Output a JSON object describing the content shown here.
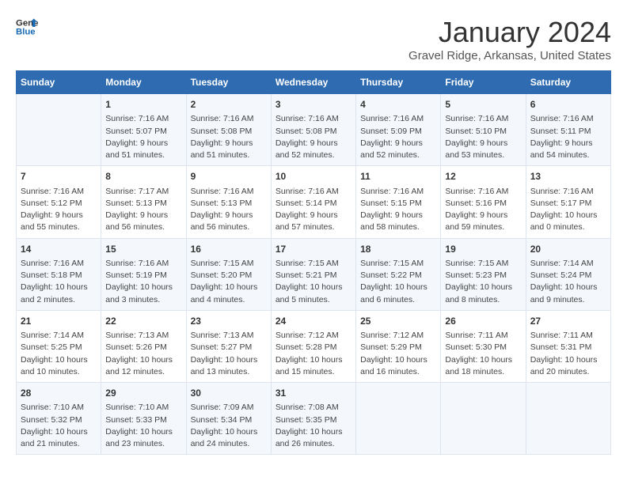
{
  "logo": {
    "line1": "General",
    "line2": "Blue"
  },
  "title": "January 2024",
  "subtitle": "Gravel Ridge, Arkansas, United States",
  "days_of_week": [
    "Sunday",
    "Monday",
    "Tuesday",
    "Wednesday",
    "Thursday",
    "Friday",
    "Saturday"
  ],
  "weeks": [
    [
      {
        "num": "",
        "info": ""
      },
      {
        "num": "1",
        "info": "Sunrise: 7:16 AM\nSunset: 5:07 PM\nDaylight: 9 hours\nand 51 minutes."
      },
      {
        "num": "2",
        "info": "Sunrise: 7:16 AM\nSunset: 5:08 PM\nDaylight: 9 hours\nand 51 minutes."
      },
      {
        "num": "3",
        "info": "Sunrise: 7:16 AM\nSunset: 5:08 PM\nDaylight: 9 hours\nand 52 minutes."
      },
      {
        "num": "4",
        "info": "Sunrise: 7:16 AM\nSunset: 5:09 PM\nDaylight: 9 hours\nand 52 minutes."
      },
      {
        "num": "5",
        "info": "Sunrise: 7:16 AM\nSunset: 5:10 PM\nDaylight: 9 hours\nand 53 minutes."
      },
      {
        "num": "6",
        "info": "Sunrise: 7:16 AM\nSunset: 5:11 PM\nDaylight: 9 hours\nand 54 minutes."
      }
    ],
    [
      {
        "num": "7",
        "info": "Sunrise: 7:16 AM\nSunset: 5:12 PM\nDaylight: 9 hours\nand 55 minutes."
      },
      {
        "num": "8",
        "info": "Sunrise: 7:17 AM\nSunset: 5:13 PM\nDaylight: 9 hours\nand 56 minutes."
      },
      {
        "num": "9",
        "info": "Sunrise: 7:16 AM\nSunset: 5:13 PM\nDaylight: 9 hours\nand 56 minutes."
      },
      {
        "num": "10",
        "info": "Sunrise: 7:16 AM\nSunset: 5:14 PM\nDaylight: 9 hours\nand 57 minutes."
      },
      {
        "num": "11",
        "info": "Sunrise: 7:16 AM\nSunset: 5:15 PM\nDaylight: 9 hours\nand 58 minutes."
      },
      {
        "num": "12",
        "info": "Sunrise: 7:16 AM\nSunset: 5:16 PM\nDaylight: 9 hours\nand 59 minutes."
      },
      {
        "num": "13",
        "info": "Sunrise: 7:16 AM\nSunset: 5:17 PM\nDaylight: 10 hours\nand 0 minutes."
      }
    ],
    [
      {
        "num": "14",
        "info": "Sunrise: 7:16 AM\nSunset: 5:18 PM\nDaylight: 10 hours\nand 2 minutes."
      },
      {
        "num": "15",
        "info": "Sunrise: 7:16 AM\nSunset: 5:19 PM\nDaylight: 10 hours\nand 3 minutes."
      },
      {
        "num": "16",
        "info": "Sunrise: 7:15 AM\nSunset: 5:20 PM\nDaylight: 10 hours\nand 4 minutes."
      },
      {
        "num": "17",
        "info": "Sunrise: 7:15 AM\nSunset: 5:21 PM\nDaylight: 10 hours\nand 5 minutes."
      },
      {
        "num": "18",
        "info": "Sunrise: 7:15 AM\nSunset: 5:22 PM\nDaylight: 10 hours\nand 6 minutes."
      },
      {
        "num": "19",
        "info": "Sunrise: 7:15 AM\nSunset: 5:23 PM\nDaylight: 10 hours\nand 8 minutes."
      },
      {
        "num": "20",
        "info": "Sunrise: 7:14 AM\nSunset: 5:24 PM\nDaylight: 10 hours\nand 9 minutes."
      }
    ],
    [
      {
        "num": "21",
        "info": "Sunrise: 7:14 AM\nSunset: 5:25 PM\nDaylight: 10 hours\nand 10 minutes."
      },
      {
        "num": "22",
        "info": "Sunrise: 7:13 AM\nSunset: 5:26 PM\nDaylight: 10 hours\nand 12 minutes."
      },
      {
        "num": "23",
        "info": "Sunrise: 7:13 AM\nSunset: 5:27 PM\nDaylight: 10 hours\nand 13 minutes."
      },
      {
        "num": "24",
        "info": "Sunrise: 7:12 AM\nSunset: 5:28 PM\nDaylight: 10 hours\nand 15 minutes."
      },
      {
        "num": "25",
        "info": "Sunrise: 7:12 AM\nSunset: 5:29 PM\nDaylight: 10 hours\nand 16 minutes."
      },
      {
        "num": "26",
        "info": "Sunrise: 7:11 AM\nSunset: 5:30 PM\nDaylight: 10 hours\nand 18 minutes."
      },
      {
        "num": "27",
        "info": "Sunrise: 7:11 AM\nSunset: 5:31 PM\nDaylight: 10 hours\nand 20 minutes."
      }
    ],
    [
      {
        "num": "28",
        "info": "Sunrise: 7:10 AM\nSunset: 5:32 PM\nDaylight: 10 hours\nand 21 minutes."
      },
      {
        "num": "29",
        "info": "Sunrise: 7:10 AM\nSunset: 5:33 PM\nDaylight: 10 hours\nand 23 minutes."
      },
      {
        "num": "30",
        "info": "Sunrise: 7:09 AM\nSunset: 5:34 PM\nDaylight: 10 hours\nand 24 minutes."
      },
      {
        "num": "31",
        "info": "Sunrise: 7:08 AM\nSunset: 5:35 PM\nDaylight: 10 hours\nand 26 minutes."
      },
      {
        "num": "",
        "info": ""
      },
      {
        "num": "",
        "info": ""
      },
      {
        "num": "",
        "info": ""
      }
    ]
  ]
}
